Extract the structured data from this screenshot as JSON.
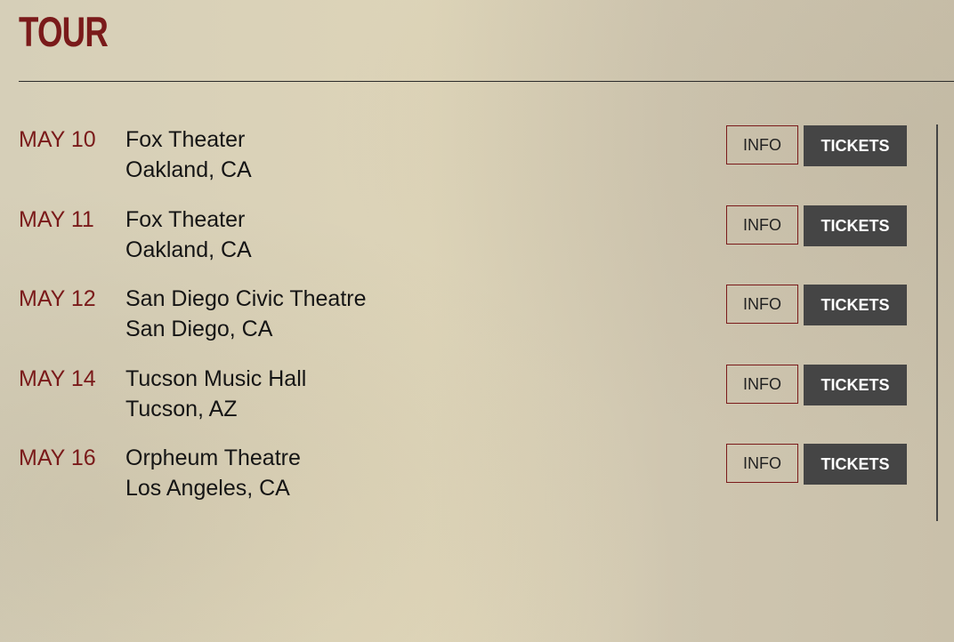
{
  "page": {
    "title": "TOUR"
  },
  "events": [
    {
      "date": "MAY 10",
      "venue": "Fox Theater",
      "city": "Oakland, CA",
      "info_label": "INFO",
      "tickets_label": "TICKETS"
    },
    {
      "date": "MAY 11",
      "venue": "Fox Theater",
      "city": "Oakland, CA",
      "info_label": "INFO",
      "tickets_label": "TICKETS"
    },
    {
      "date": "MAY 12",
      "venue": "San Diego Civic Theatre",
      "city": "San Diego, CA",
      "info_label": "INFO",
      "tickets_label": "TICKETS"
    },
    {
      "date": "MAY 14",
      "venue": "Tucson Music Hall",
      "city": "Tucson, AZ",
      "info_label": "INFO",
      "tickets_label": "TICKETS"
    },
    {
      "date": "MAY 16",
      "venue": "Orpheum Theatre",
      "city": "Los Angeles, CA",
      "info_label": "INFO",
      "tickets_label": "TICKETS"
    }
  ],
  "colors": {
    "accent": "#7a1a1a",
    "button_dark": "#454545",
    "text": "#151515"
  }
}
